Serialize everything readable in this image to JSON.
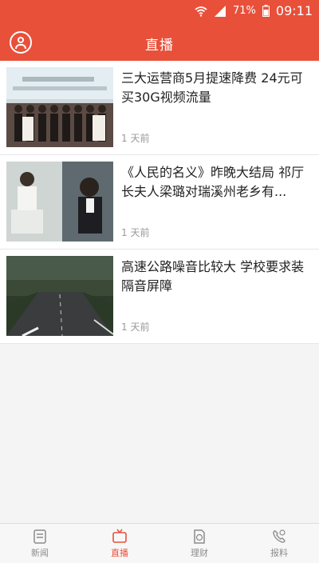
{
  "status_bar": {
    "battery": "71%",
    "time": "09:11"
  },
  "header": {
    "title": "直播"
  },
  "news": [
    {
      "title": "三大运营商5月提速降费 24元可买30G视频流量",
      "time": "1 天前",
      "thumb_desc": "group-photo-thumbnail"
    },
    {
      "title": "《人民的名义》昨晚大结局 祁厅长夫人梁璐对瑞溪州老乡有...",
      "time": "1 天前",
      "thumb_desc": "tv-drama-still-thumbnail"
    },
    {
      "title": "高速公路噪音比较大 学校要求装隔音屏障",
      "time": "1 天前",
      "thumb_desc": "highway-night-thumbnail"
    }
  ],
  "bottom_nav": [
    {
      "label": "新闻",
      "icon": "news-icon",
      "active": false
    },
    {
      "label": "直播",
      "icon": "live-tv-icon",
      "active": true
    },
    {
      "label": "理财",
      "icon": "finance-icon",
      "active": false
    },
    {
      "label": "报料",
      "icon": "phone-report-icon",
      "active": false
    }
  ],
  "colors": {
    "brand": "#e8503a",
    "text": "#222222",
    "muted": "#999999"
  }
}
